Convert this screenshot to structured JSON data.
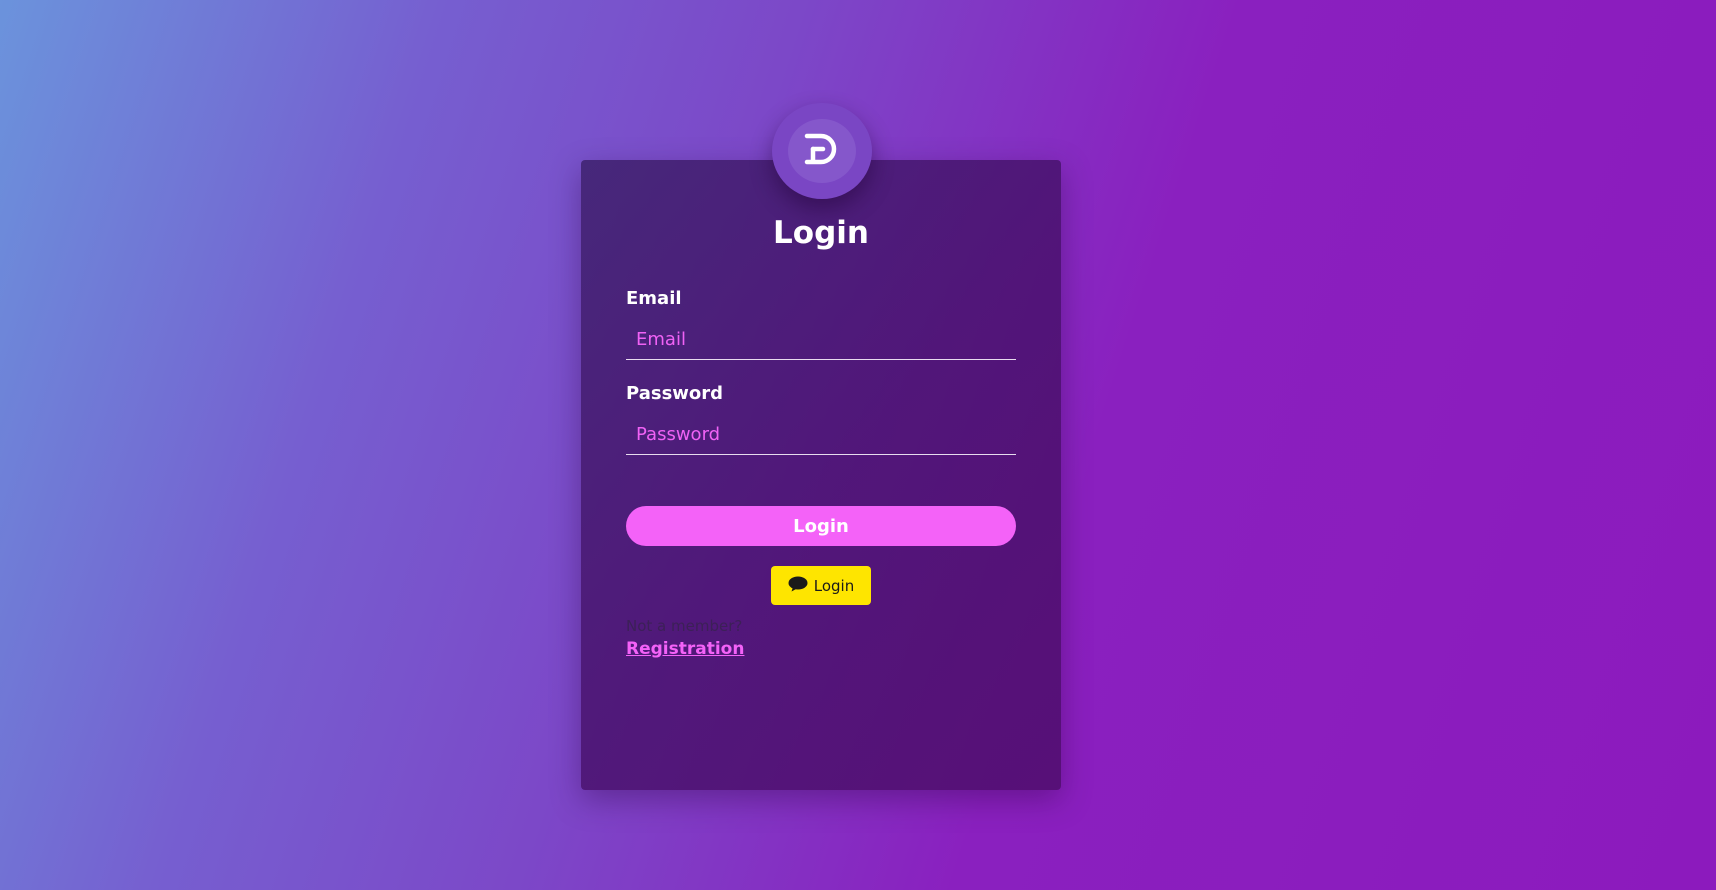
{
  "brand": {
    "logo_icon": "ed-logo-icon"
  },
  "login_form": {
    "title": "Login",
    "email": {
      "label": "Email",
      "placeholder": "Email",
      "value": ""
    },
    "password": {
      "label": "Password",
      "placeholder": "Password",
      "value": ""
    },
    "submit_label": "Login",
    "kakao": {
      "icon": "chat-bubble-icon",
      "label": "Login"
    },
    "not_member_text": "Not a member?",
    "registration_link": "Registration"
  },
  "colors": {
    "accent": "#f462f8",
    "kakao_yellow": "#fee500",
    "card_bg": "#4a1670"
  }
}
